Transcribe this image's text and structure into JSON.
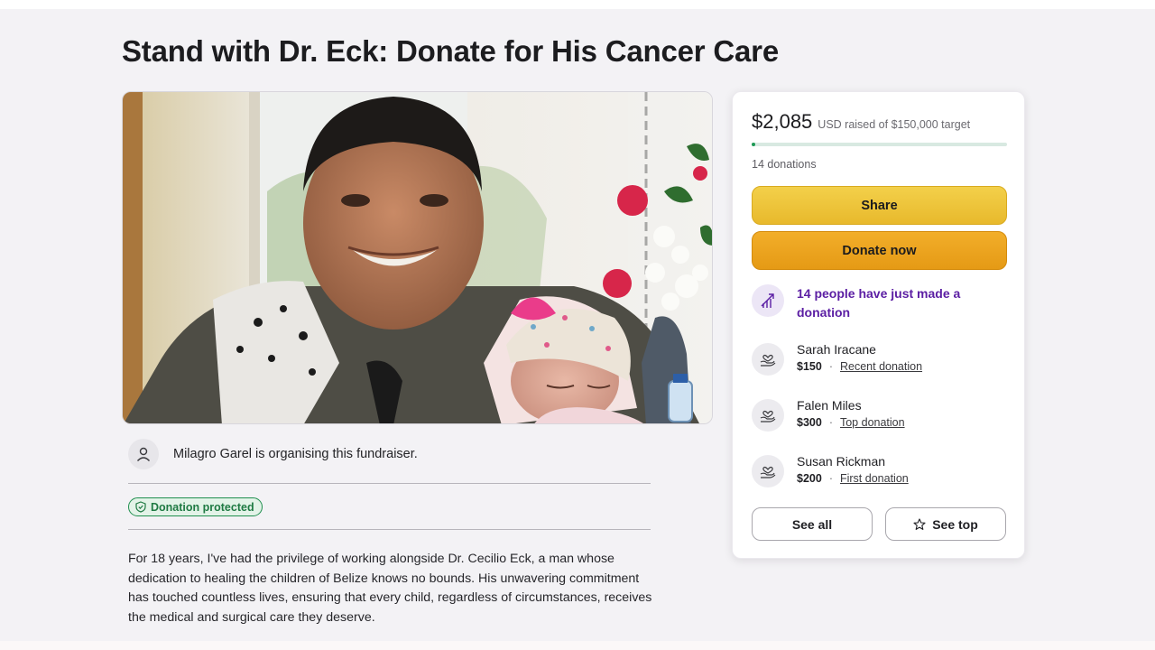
{
  "page": {
    "title": "Stand with Dr. Eck: Donate for His Cancer Care"
  },
  "organiser": {
    "text": "Milagro Garel is organising this fundraiser.",
    "avatar_icon": "person-icon"
  },
  "badge": {
    "label": "Donation protected",
    "icon": "shield-icon",
    "color": "#1f7a43"
  },
  "story": {
    "text": "For 18 years, I've had the privilege of working alongside Dr. Cecilio Eck, a man whose dedication to healing the children of Belize knows no bounds. His unwavering commitment has touched countless lives, ensuring that every child, regardless of circumstances, receives the medical and surgical care they deserve."
  },
  "donation_card": {
    "amount": "$2,085",
    "raised_text": "USD raised of $150,000 target",
    "progress_fraction": 0.0139,
    "donations_count": "14 donations",
    "share_label": "Share",
    "donate_label": "Donate now",
    "activity": {
      "text": "14 people have just made a donation",
      "icon": "trending-up-icon"
    },
    "donors": [
      {
        "name": "Sarah Iracane",
        "amount": "$150",
        "tag": "Recent donation",
        "icon": "heart-hand-icon"
      },
      {
        "name": "Falen Miles",
        "amount": "$300",
        "tag": "Top donation",
        "icon": "heart-hand-icon"
      },
      {
        "name": "Susan Rickman",
        "amount": "$200",
        "tag": "First donation",
        "icon": "heart-hand-icon"
      }
    ],
    "see_all_label": "See all",
    "see_top_label": "See top",
    "colors": {
      "share": "#f0c43c",
      "donate": "#eca321",
      "progress": "#1f9a56",
      "activity_text": "#5b1ea3"
    }
  }
}
